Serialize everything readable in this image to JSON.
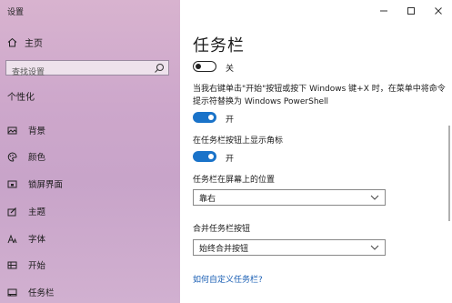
{
  "window": {
    "title": "设置"
  },
  "sidebar": {
    "home_label": "主页",
    "search_placeholder": "查找设置",
    "section_label": "个性化",
    "items": [
      {
        "label": "背景",
        "icon": "picture-icon"
      },
      {
        "label": "颜色",
        "icon": "palette-icon"
      },
      {
        "label": "锁屏界面",
        "icon": "lock-screen-icon"
      },
      {
        "label": "主题",
        "icon": "theme-brush-icon"
      },
      {
        "label": "字体",
        "icon": "font-icon"
      },
      {
        "label": "开始",
        "icon": "start-icon"
      },
      {
        "label": "任务栏",
        "icon": "taskbar-icon"
      }
    ]
  },
  "main": {
    "title": "任务栏",
    "toggle1": {
      "state": "off",
      "label": "关"
    },
    "powershell_desc": "当我右键单击\"开始\"按钮或按下 Windows 键+X 时，在菜单中将命令提示符替换为 Windows PowerShell",
    "toggle2": {
      "state": "on",
      "label": "开"
    },
    "badges_label": "在任务栏按钮上显示角标",
    "toggle3": {
      "state": "on",
      "label": "开"
    },
    "position_label": "任务栏在屏幕上的位置",
    "position_value": "靠右",
    "combine_label": "合并任务栏按钮",
    "combine_value": "始终合并按钮",
    "customize_link": "如何自定义任务栏?"
  },
  "colors": {
    "accent": "#1a73c9",
    "link": "#1a5fb4"
  }
}
